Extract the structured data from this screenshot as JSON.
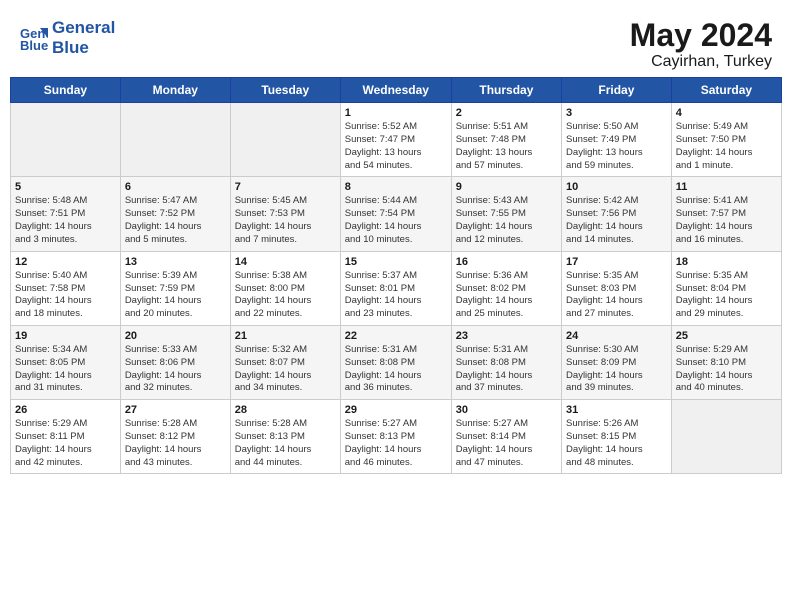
{
  "header": {
    "logo_line1": "General",
    "logo_line2": "Blue",
    "month": "May 2024",
    "location": "Cayirhan, Turkey"
  },
  "weekdays": [
    "Sunday",
    "Monday",
    "Tuesday",
    "Wednesday",
    "Thursday",
    "Friday",
    "Saturday"
  ],
  "weeks": [
    [
      {
        "day": "",
        "info": ""
      },
      {
        "day": "",
        "info": ""
      },
      {
        "day": "",
        "info": ""
      },
      {
        "day": "1",
        "info": "Sunrise: 5:52 AM\nSunset: 7:47 PM\nDaylight: 13 hours\nand 54 minutes."
      },
      {
        "day": "2",
        "info": "Sunrise: 5:51 AM\nSunset: 7:48 PM\nDaylight: 13 hours\nand 57 minutes."
      },
      {
        "day": "3",
        "info": "Sunrise: 5:50 AM\nSunset: 7:49 PM\nDaylight: 13 hours\nand 59 minutes."
      },
      {
        "day": "4",
        "info": "Sunrise: 5:49 AM\nSunset: 7:50 PM\nDaylight: 14 hours\nand 1 minute."
      }
    ],
    [
      {
        "day": "5",
        "info": "Sunrise: 5:48 AM\nSunset: 7:51 PM\nDaylight: 14 hours\nand 3 minutes."
      },
      {
        "day": "6",
        "info": "Sunrise: 5:47 AM\nSunset: 7:52 PM\nDaylight: 14 hours\nand 5 minutes."
      },
      {
        "day": "7",
        "info": "Sunrise: 5:45 AM\nSunset: 7:53 PM\nDaylight: 14 hours\nand 7 minutes."
      },
      {
        "day": "8",
        "info": "Sunrise: 5:44 AM\nSunset: 7:54 PM\nDaylight: 14 hours\nand 10 minutes."
      },
      {
        "day": "9",
        "info": "Sunrise: 5:43 AM\nSunset: 7:55 PM\nDaylight: 14 hours\nand 12 minutes."
      },
      {
        "day": "10",
        "info": "Sunrise: 5:42 AM\nSunset: 7:56 PM\nDaylight: 14 hours\nand 14 minutes."
      },
      {
        "day": "11",
        "info": "Sunrise: 5:41 AM\nSunset: 7:57 PM\nDaylight: 14 hours\nand 16 minutes."
      }
    ],
    [
      {
        "day": "12",
        "info": "Sunrise: 5:40 AM\nSunset: 7:58 PM\nDaylight: 14 hours\nand 18 minutes."
      },
      {
        "day": "13",
        "info": "Sunrise: 5:39 AM\nSunset: 7:59 PM\nDaylight: 14 hours\nand 20 minutes."
      },
      {
        "day": "14",
        "info": "Sunrise: 5:38 AM\nSunset: 8:00 PM\nDaylight: 14 hours\nand 22 minutes."
      },
      {
        "day": "15",
        "info": "Sunrise: 5:37 AM\nSunset: 8:01 PM\nDaylight: 14 hours\nand 23 minutes."
      },
      {
        "day": "16",
        "info": "Sunrise: 5:36 AM\nSunset: 8:02 PM\nDaylight: 14 hours\nand 25 minutes."
      },
      {
        "day": "17",
        "info": "Sunrise: 5:35 AM\nSunset: 8:03 PM\nDaylight: 14 hours\nand 27 minutes."
      },
      {
        "day": "18",
        "info": "Sunrise: 5:35 AM\nSunset: 8:04 PM\nDaylight: 14 hours\nand 29 minutes."
      }
    ],
    [
      {
        "day": "19",
        "info": "Sunrise: 5:34 AM\nSunset: 8:05 PM\nDaylight: 14 hours\nand 31 minutes."
      },
      {
        "day": "20",
        "info": "Sunrise: 5:33 AM\nSunset: 8:06 PM\nDaylight: 14 hours\nand 32 minutes."
      },
      {
        "day": "21",
        "info": "Sunrise: 5:32 AM\nSunset: 8:07 PM\nDaylight: 14 hours\nand 34 minutes."
      },
      {
        "day": "22",
        "info": "Sunrise: 5:31 AM\nSunset: 8:08 PM\nDaylight: 14 hours\nand 36 minutes."
      },
      {
        "day": "23",
        "info": "Sunrise: 5:31 AM\nSunset: 8:08 PM\nDaylight: 14 hours\nand 37 minutes."
      },
      {
        "day": "24",
        "info": "Sunrise: 5:30 AM\nSunset: 8:09 PM\nDaylight: 14 hours\nand 39 minutes."
      },
      {
        "day": "25",
        "info": "Sunrise: 5:29 AM\nSunset: 8:10 PM\nDaylight: 14 hours\nand 40 minutes."
      }
    ],
    [
      {
        "day": "26",
        "info": "Sunrise: 5:29 AM\nSunset: 8:11 PM\nDaylight: 14 hours\nand 42 minutes."
      },
      {
        "day": "27",
        "info": "Sunrise: 5:28 AM\nSunset: 8:12 PM\nDaylight: 14 hours\nand 43 minutes."
      },
      {
        "day": "28",
        "info": "Sunrise: 5:28 AM\nSunset: 8:13 PM\nDaylight: 14 hours\nand 44 minutes."
      },
      {
        "day": "29",
        "info": "Sunrise: 5:27 AM\nSunset: 8:13 PM\nDaylight: 14 hours\nand 46 minutes."
      },
      {
        "day": "30",
        "info": "Sunrise: 5:27 AM\nSunset: 8:14 PM\nDaylight: 14 hours\nand 47 minutes."
      },
      {
        "day": "31",
        "info": "Sunrise: 5:26 AM\nSunset: 8:15 PM\nDaylight: 14 hours\nand 48 minutes."
      },
      {
        "day": "",
        "info": ""
      }
    ]
  ]
}
